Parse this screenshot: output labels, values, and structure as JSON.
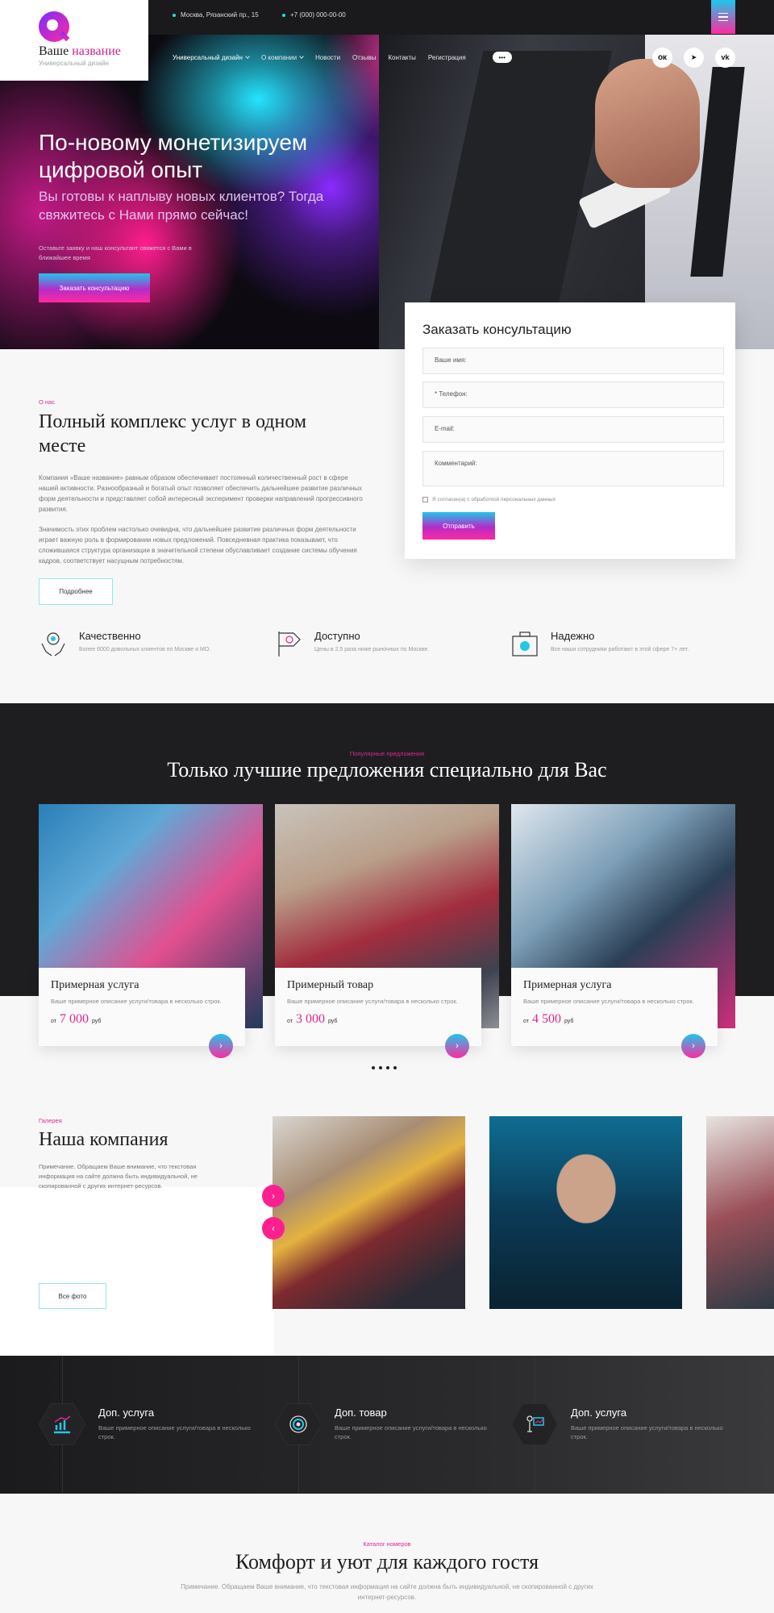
{
  "brand": {
    "name_part1": "Ваше ",
    "name_part2": "название",
    "tagline": "Универсальный дизайн"
  },
  "topbar": {
    "address": "Москва, Рязанский пр., 15",
    "phone": "+7 (000) 000-00-00"
  },
  "nav": {
    "items": [
      {
        "label": "Универсальный дизайн",
        "dropdown": true
      },
      {
        "label": "О компании",
        "dropdown": true
      },
      {
        "label": "Новости",
        "dropdown": false
      },
      {
        "label": "Отзывы",
        "dropdown": false
      },
      {
        "label": "Контакты",
        "dropdown": false
      },
      {
        "label": "Регистрация",
        "dropdown": false
      }
    ],
    "more_label": "•••",
    "social": [
      "ok",
      "tg",
      "vk"
    ],
    "social_labels": {
      "ok": "ок",
      "tg": "➤",
      "vk": "vk"
    }
  },
  "hero": {
    "title": "По-новому монетизируем цифровой опыт",
    "subtitle": "Вы готовы к наплыву новых клиентов? Тогда свяжитесь с Нами прямо сейчас!",
    "note": "Оставьте заявку и наш консультант свяжется с Вами в ближайшее время",
    "cta": "Заказать консультацию"
  },
  "form": {
    "title": "Заказать консультацию",
    "fields": {
      "name": "Ваше имя:",
      "phone": "* Телефон:",
      "email": "E-mail:",
      "comment": "Комментарий:"
    },
    "consent": "Я согласен(а) с обработкой персональных данных",
    "submit": "Отправить"
  },
  "about": {
    "overline": "О нас",
    "title": "Полный комплекс услуг в одном месте",
    "p1": "Компания «Ваше название» равным образом обеспечивает постоянный количественный рост в сфере нашей активности. Разнообразный и богатый опыт позволяет обеспечить дальнейшее развитие различных форм деятельности и представляет собой интересный эксперимент проверки направлений прогрессивного развития.",
    "p2": "Значимость этих проблем настолько очевидна, что дальнейшее развитие различных форм деятельности играет важную роль в формировании новых предложений. Повседневная практика показывает, что сложившаяся структура организации в значительной степени обуславливает создание системы обучения кадров, соответствует насущным потребностям.",
    "more": "Подробнее"
  },
  "features": [
    {
      "title": "Качественно",
      "text": "Более 6000 довольных клиентов по Москве и МО."
    },
    {
      "title": "Доступно",
      "text": "Цены в 2,5 раза ниже рыночных по Москве."
    },
    {
      "title": "Надежно",
      "text": "Все наши сотрудники работают в этой сфере 7+ лет."
    }
  ],
  "offers": {
    "overline": "Популярные предложения",
    "title": "Только лучшие предложения специально для Вас",
    "cards": [
      {
        "title": "Примерная услуга",
        "desc": "Ваше примерное описание услуги/товара в несколько строк.",
        "from": "от",
        "price": "7 000",
        "currency": "руб"
      },
      {
        "title": "Примерный товар",
        "desc": "Ваше примерное описание услуги/товара в несколько строк.",
        "from": "от",
        "price": "3 000",
        "currency": "руб"
      },
      {
        "title": "Примерная услуга",
        "desc": "Ваше примерное описание услуги/товара в несколько строк.",
        "from": "от",
        "price": "4 500",
        "currency": "руб"
      }
    ]
  },
  "gallery": {
    "overline": "Галерея",
    "title": "Наша компания",
    "text": "Примечание. Обращаем Ваше внимание, что текстовая информация на сайте должна быть индивидуальной, не скопированной с других интернет-ресурсов.",
    "button": "Все фото"
  },
  "services": [
    {
      "title": "Доп. услуга",
      "text": "Ваше примерное описание услуги/товара в несколько строк."
    },
    {
      "title": "Доп. товар",
      "text": "Ваше примерное описание услуги/товара в несколько строк."
    },
    {
      "title": "Доп. услуга",
      "text": "Ваше примерное описание услуги/товара в несколько строк."
    }
  ],
  "catalog": {
    "overline": "Каталог номеров",
    "title": "Комфорт и уют для каждого гостя",
    "text": "Примечание. Обращаем Ваше внимание, что текстовая информация на сайте должна быть индивидуальной, не скопированной с других интернет-ресурсов."
  },
  "colors": {
    "accent": "#e0258f",
    "cyan": "#1fc6ea",
    "dark": "#1e1e20"
  }
}
